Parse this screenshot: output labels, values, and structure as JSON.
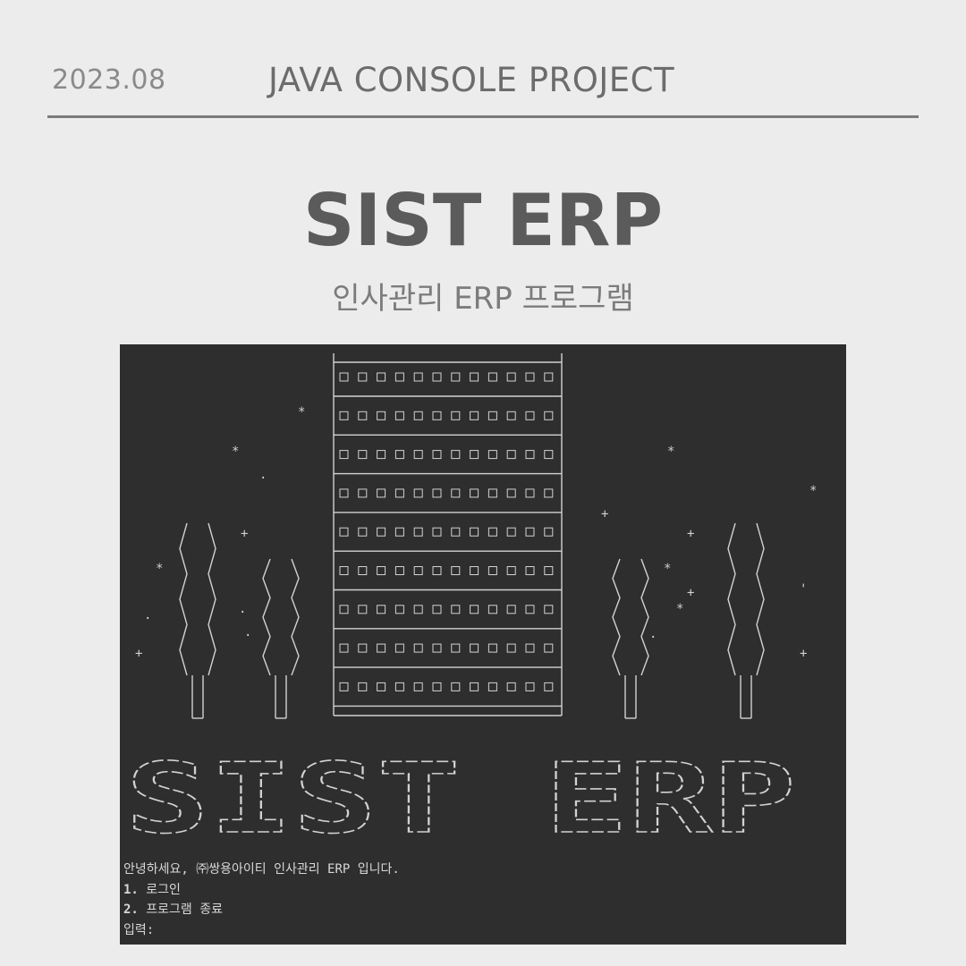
{
  "header": {
    "date": "2023.08",
    "title": "JAVA CONSOLE PROJECT"
  },
  "hero": {
    "title": "SIST ERP",
    "subtitle": "인사관리 ERP 프로그램"
  },
  "console": {
    "banner_text": "SIST ERP",
    "greeting": "안녕하세요, ㈜쌍용아이티 인사관리 ERP 입니다.",
    "menu": [
      {
        "number": "1.",
        "label": "로그인"
      },
      {
        "number": "2.",
        "label": "프로그램 종료"
      }
    ],
    "prompt": "입력:"
  }
}
